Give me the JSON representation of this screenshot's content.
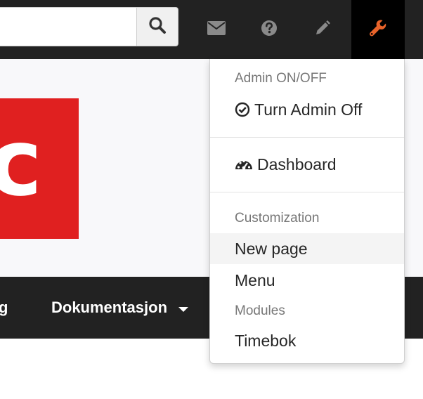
{
  "search": {
    "value": "",
    "placeholder": ""
  },
  "topbar": {
    "icons": [
      "search-icon",
      "envelope-icon",
      "question-circle-icon",
      "pencil-icon",
      "wrench-icon"
    ],
    "accent_color": "#e8632a",
    "icon_color": "#8a8a8a"
  },
  "logo": {
    "letter": "c",
    "color": "#e02020"
  },
  "navbar": {
    "items": [
      {
        "label": "g"
      },
      {
        "label": "Dokumentasjon"
      }
    ]
  },
  "admin_menu": {
    "admin_header": "Admin ON/OFF",
    "turn_admin_off": "Turn Admin Off",
    "dashboard": "Dashboard",
    "customization_header": "Customization",
    "new_page": "New page",
    "menu": "Menu",
    "modules_header": "Modules",
    "timebok": "Timebok"
  }
}
